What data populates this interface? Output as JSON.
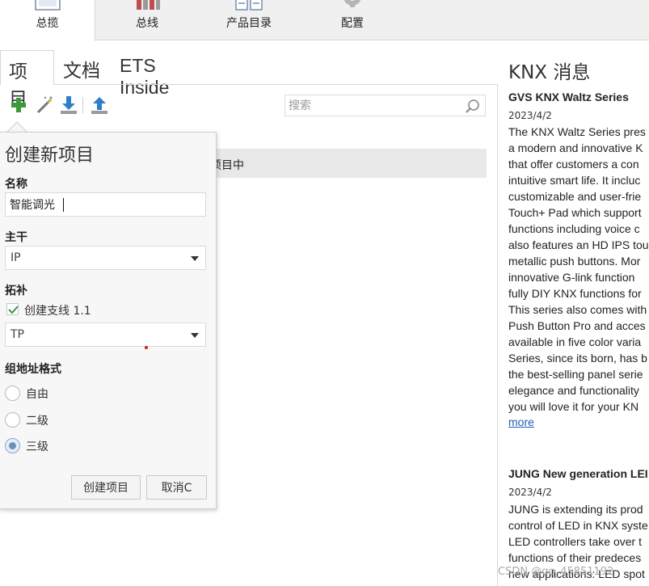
{
  "ribbon": {
    "tabs": [
      {
        "label": "总揽",
        "icon": "overview-icon"
      },
      {
        "label": "总线",
        "icon": "bus-icon"
      },
      {
        "label": "产品目录",
        "icon": "catalog-icon"
      },
      {
        "label": "配置",
        "icon": "gear-icon"
      }
    ]
  },
  "left": {
    "tabs": [
      "项目",
      "文档",
      "ETS Inside"
    ],
    "toolbar": [
      "add-icon",
      "wand-icon",
      "import-icon",
      "export-icon"
    ],
    "search_placeholder": "搜索",
    "list_row_text": "项目中"
  },
  "popup": {
    "title": "创建新项目",
    "name_label": "名称",
    "name_value": "智能调光",
    "backbone_label": "主干",
    "backbone_value": "IP",
    "topology_label": "拓补",
    "create_line_label": "创建支线 1.1",
    "create_line_checked": true,
    "topology_value": "TP",
    "group_address_label": "组地址格式",
    "radio_options": [
      {
        "label": "自由",
        "checked": false
      },
      {
        "label": "二级",
        "checked": false
      },
      {
        "label": "三级",
        "checked": true
      }
    ],
    "create_button": "创建项目",
    "cancel_button": "取消C"
  },
  "news": {
    "title": "KNX 消息",
    "items": [
      {
        "headline": "GVS KNX Waltz Series",
        "date": "2023/4/2",
        "lines": [
          "The KNX Waltz Series pres",
          "a modern and innovative K",
          "that offer customers a con",
          "intuitive smart life. It incluc",
          "customizable and user-frie",
          "Touch+ Pad which support",
          "functions including voice c",
          "also features an HD IPS tou",
          "metallic push buttons. Mor",
          "innovative G-link function",
          "fully DIY KNX functions for",
          "This series also comes with",
          "Push Button Pro and acces",
          "available in five color varia",
          "Series, since its born, has b",
          "the best-selling panel serie",
          "elegance and functionality",
          "you will love it for your KN"
        ],
        "more": "more"
      },
      {
        "headline": "JUNG New generation LEI",
        "date": "2023/4/2",
        "lines": [
          "JUNG is extending its prod",
          "control of LED in KNX syste",
          "LED controllers take over t",
          "functions of their predeces",
          "new applications: LED spot"
        ]
      }
    ]
  },
  "watermark": "CSDN @qq_45851192"
}
